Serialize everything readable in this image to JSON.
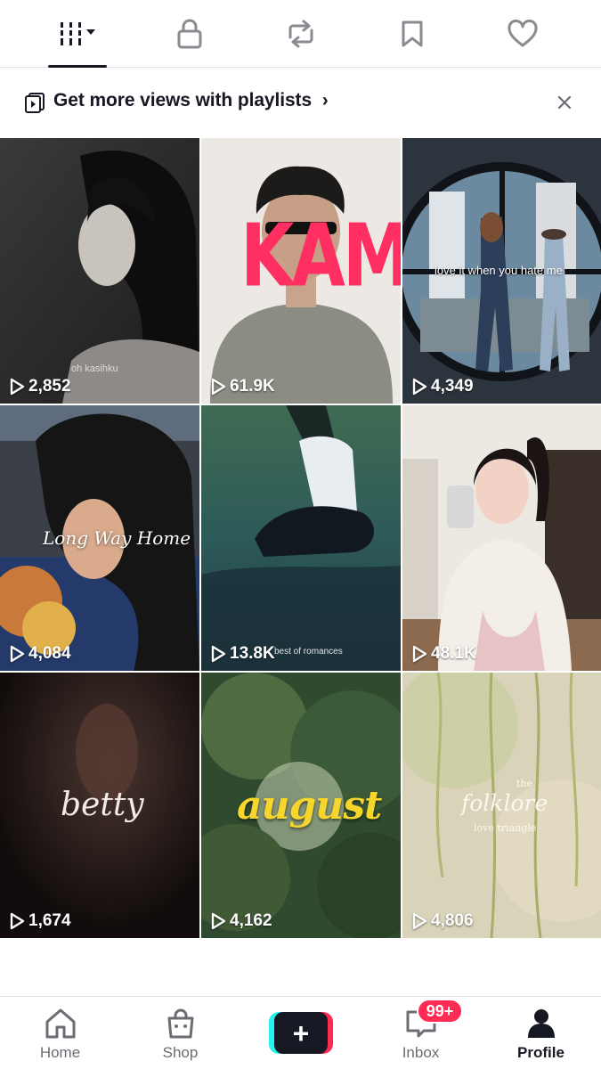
{
  "top_tabs": [
    {
      "name": "videos-grid",
      "icon": "grid-bars-icon"
    },
    {
      "name": "private",
      "icon": "lock-icon"
    },
    {
      "name": "reposts",
      "icon": "repost-icon"
    },
    {
      "name": "favorites",
      "icon": "bookmark-icon"
    },
    {
      "name": "liked",
      "icon": "heart-icon"
    }
  ],
  "banner": {
    "text": "Get more views with playlists",
    "chevron": "›",
    "close": "×"
  },
  "videos": [
    {
      "views": "2,852",
      "caption": "oh kasihku"
    },
    {
      "views": "61.9K",
      "caption": "KAMU"
    },
    {
      "views": "4,349",
      "caption": "love it when you hate me"
    },
    {
      "views": "4,084",
      "caption": "Long Way Home"
    },
    {
      "views": "13.8K",
      "caption": "best of romances"
    },
    {
      "views": "48.1K",
      "caption": ""
    },
    {
      "views": "1,674",
      "caption": "betty"
    },
    {
      "views": "4,162",
      "caption": "august"
    },
    {
      "views": "4,806",
      "caption": "folklore",
      "caption_top": "the",
      "caption_sub": "love triangle"
    }
  ],
  "bottom_nav": {
    "home": "Home",
    "shop": "Shop",
    "create": "+",
    "inbox": "Inbox",
    "inbox_badge": "99+",
    "profile": "Profile"
  },
  "colors": {
    "accent_red": "#fe2c55",
    "accent_cyan": "#25f4ee",
    "text_dark": "#161823",
    "text_muted": "#6b6d74"
  }
}
